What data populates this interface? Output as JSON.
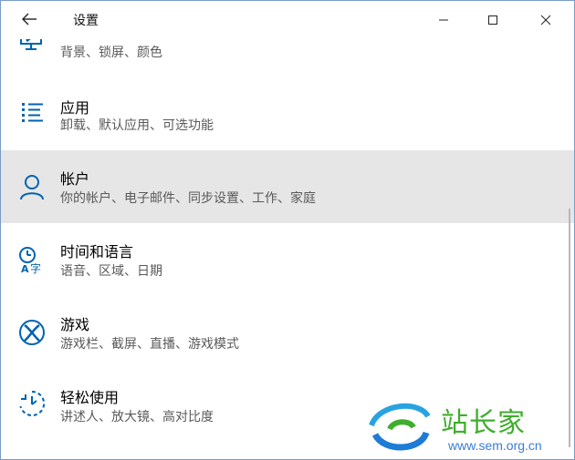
{
  "window": {
    "title": "设置"
  },
  "icons": {
    "back": "arrow-left-icon",
    "minimize": "minimize-icon",
    "maximize": "maximize-icon",
    "close": "close-icon"
  },
  "items": [
    {
      "key": "personalization",
      "name": "",
      "desc": "背景、锁屏、颜色",
      "icon": "personalization-icon",
      "selected": false
    },
    {
      "key": "apps",
      "name": "应用",
      "desc": "卸载、默认应用、可选功能",
      "icon": "apps-list-icon",
      "selected": false
    },
    {
      "key": "accounts",
      "name": "帐户",
      "desc": "你的帐户、电子邮件、同步设置、工作、家庭",
      "icon": "person-icon",
      "selected": true
    },
    {
      "key": "time-language",
      "name": "时间和语言",
      "desc": "语音、区域、日期",
      "icon": "time-language-icon",
      "selected": false
    },
    {
      "key": "gaming",
      "name": "游戏",
      "desc": "游戏栏、截屏、直播、游戏模式",
      "icon": "xbox-icon",
      "selected": false
    },
    {
      "key": "ease-of-access",
      "name": "轻松使用",
      "desc": "讲述人、放大镜、高对比度",
      "icon": "ease-of-access-icon",
      "selected": false
    }
  ],
  "watermark": {
    "title": "站长家",
    "url": "www.sem.org.cn"
  },
  "colors": {
    "accent": "#0063b1",
    "selected_bg": "#e6e6e6",
    "watermark_green": "#3fae2c",
    "watermark_blue": "#3a7bd5"
  }
}
